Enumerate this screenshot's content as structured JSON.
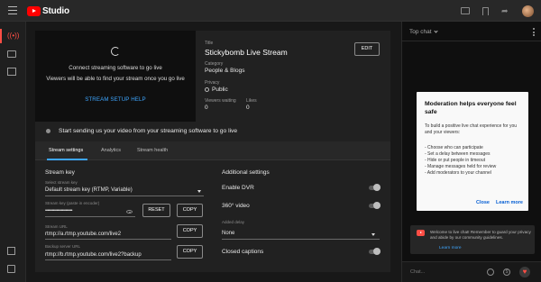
{
  "header": {
    "app_name": "Studio",
    "icons": [
      "menu-icon",
      "captions-icon",
      "bookmark-icon",
      "share-icon",
      "account-avatar"
    ]
  },
  "rail": {
    "items": [
      "live-icon",
      "camera-icon",
      "calendar-icon"
    ],
    "bottom_items": [
      "exit-icon",
      "feedback-icon"
    ]
  },
  "preview": {
    "line1": "Connect streaming software to go live",
    "line2": "Viewers will be able to find your stream once you go live",
    "setup_link": "STREAM SETUP HELP"
  },
  "meta": {
    "title_label": "Title",
    "title": "Stickybomb Live Stream",
    "category_label": "Category",
    "category": "People & Blogs",
    "privacy_label": "Privacy",
    "privacy": "Public",
    "viewers_label": "Viewers waiting",
    "viewers": "0",
    "likes_label": "Likes",
    "likes": "0",
    "edit_button": "EDIT"
  },
  "start_row": {
    "text": "Start sending us your video from your streaming software to go live"
  },
  "tabs": [
    {
      "label": "Stream settings",
      "active": true
    },
    {
      "label": "Analytics",
      "active": false
    },
    {
      "label": "Stream health",
      "active": false
    }
  ],
  "stream_key": {
    "section_title": "Stream key",
    "select_label": "Select stream key",
    "select_value": "Default stream key (RTMP, Variable)",
    "key_label": "Stream key (paste in encoder)",
    "key_value": "••••••••••••••••••••••••",
    "reset_button": "RESET",
    "copy_button": "COPY",
    "url_label": "Stream URL",
    "url_value": "rtmp://a.rtmp.youtube.com/live2",
    "url_copy": "COPY",
    "backup_label": "Backup server URL",
    "backup_value": "rtmp://b.rtmp.youtube.com/live2?backup",
    "backup_copy": "COPY"
  },
  "additional": {
    "section_title": "Additional settings",
    "dvr_label": "Enable DVR",
    "video360_label": "360° video",
    "delay_label": "Added delay",
    "delay_value": "None",
    "captions_label": "Closed captions"
  },
  "chat": {
    "title": "Top chat",
    "mod_title": "Moderation helps everyone feel safe",
    "mod_intro": "To build a positive live chat experience for you and your viewers:",
    "mod_items": [
      "- Choose who can participate",
      "- Set a delay between messages",
      "- Hide or put people in timeout",
      "- Manage messages held for review",
      "- Add moderators to your channel"
    ],
    "mod_close": "Close",
    "mod_learn": "Learn more",
    "welcome_text": "Welcome to live chat! Remember to guard your privacy and abide by our community guidelines.",
    "welcome_link": "Learn more",
    "input_placeholder": "Chat..."
  },
  "colors": {
    "accent": "#3ea6ff",
    "brand": "#ff0000",
    "live": "#ff4e45"
  }
}
